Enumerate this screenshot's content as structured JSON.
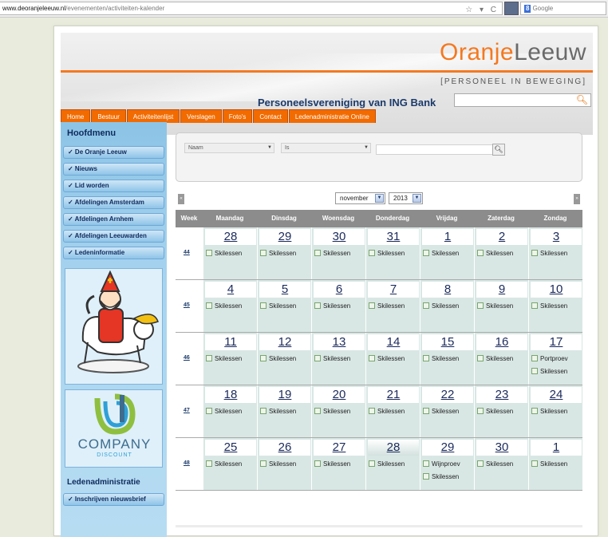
{
  "browser": {
    "url_domain": "www.deoranjeleeuw.nl",
    "url_path": "/evenementen/activiteiten-kalender",
    "url_icons": "☆ ▾ C",
    "search_engine": "8",
    "search_placeholder": "Google"
  },
  "header": {
    "logo_part1": "Oranje",
    "logo_part2": "Leeuw",
    "tagline": "[PERSONEEL IN BEWEGING]",
    "subtitle": "Personeelsvereniging van ING Bank",
    "search_icon": "magnifier-icon"
  },
  "nav": [
    "Home",
    "Bestuur",
    "Activiteitenlijst",
    "Verslagen",
    "Foto's",
    "Contact",
    "Ledenadministratie Online"
  ],
  "sidebar": {
    "title": "Hoofdmenu",
    "items": [
      "✓ De Oranje Leeuw",
      "✓ Nieuws",
      "✓ Lid worden",
      "✓ Afdelingen Amsterdam",
      "✓ Afdelingen Arnhem",
      "✓ Afdelingen Leeuwarden",
      "✓ Ledeninformatie"
    ],
    "company_word": "COMPANY",
    "company_sub": "DISCOUNT",
    "ledenadmin_title": "Ledenadministratie",
    "ledenadmin_item": "✓ Inschrijven nieuwsbrief"
  },
  "filters": {
    "category": "Naam",
    "operator": "Is",
    "search_button": "magnifier-icon",
    "month": "november",
    "year": "2013",
    "prev": "«",
    "next": "»"
  },
  "calendar": {
    "headers": [
      "Week",
      "Maandag",
      "Dinsdag",
      "Woensdag",
      "Donderdag",
      "Vrijdag",
      "Zaterdag",
      "Zondag"
    ],
    "rows": [
      {
        "week": "44",
        "days": [
          {
            "num": "28",
            "events": [
              "Skilessen"
            ]
          },
          {
            "num": "29",
            "events": [
              "Skilessen"
            ]
          },
          {
            "num": "30",
            "events": [
              "Skilessen"
            ]
          },
          {
            "num": "31",
            "events": [
              "Skilessen"
            ]
          },
          {
            "num": "1",
            "events": [
              "Skilessen"
            ]
          },
          {
            "num": "2",
            "events": [
              "Skilessen"
            ]
          },
          {
            "num": "3",
            "events": [
              "Skilessen"
            ]
          }
        ]
      },
      {
        "week": "45",
        "days": [
          {
            "num": "4",
            "events": [
              "Skilessen"
            ]
          },
          {
            "num": "5",
            "events": [
              "Skilessen"
            ]
          },
          {
            "num": "6",
            "events": [
              "Skilessen"
            ]
          },
          {
            "num": "7",
            "events": [
              "Skilessen"
            ]
          },
          {
            "num": "8",
            "events": [
              "Skilessen"
            ]
          },
          {
            "num": "9",
            "events": [
              "Skilessen"
            ]
          },
          {
            "num": "10",
            "events": [
              "Skilessen"
            ]
          }
        ]
      },
      {
        "week": "46",
        "days": [
          {
            "num": "11",
            "events": [
              "Skilessen"
            ]
          },
          {
            "num": "12",
            "events": [
              "Skilessen"
            ]
          },
          {
            "num": "13",
            "events": [
              "Skilessen"
            ]
          },
          {
            "num": "14",
            "events": [
              "Skilessen"
            ]
          },
          {
            "num": "15",
            "events": [
              "Skilessen"
            ]
          },
          {
            "num": "16",
            "events": [
              "Skilessen"
            ]
          },
          {
            "num": "17",
            "events": [
              "Portproev",
              "Skilessen"
            ]
          }
        ]
      },
      {
        "week": "47",
        "days": [
          {
            "num": "18",
            "events": [
              "Skilessen"
            ]
          },
          {
            "num": "19",
            "events": [
              "Skilessen"
            ]
          },
          {
            "num": "20",
            "events": [
              "Skilessen"
            ]
          },
          {
            "num": "21",
            "events": [
              "Skilessen"
            ]
          },
          {
            "num": "22",
            "events": [
              "Skilessen"
            ]
          },
          {
            "num": "23",
            "events": [
              "Skilessen"
            ]
          },
          {
            "num": "24",
            "events": [
              "Skilessen"
            ]
          }
        ]
      },
      {
        "week": "48",
        "days": [
          {
            "num": "25",
            "events": [
              "Skilessen"
            ]
          },
          {
            "num": "26",
            "events": [
              "Skilessen"
            ]
          },
          {
            "num": "27",
            "events": [
              "Skilessen"
            ]
          },
          {
            "num": "28",
            "events": [
              "Skilessen"
            ],
            "today": true
          },
          {
            "num": "29",
            "events": [
              "Wijnproev",
              "Skilessen"
            ]
          },
          {
            "num": "30",
            "events": [
              "Skilessen"
            ]
          },
          {
            "num": "1",
            "events": [
              "Skilessen"
            ]
          }
        ]
      }
    ]
  },
  "colors": {
    "accent": "#f26b00",
    "sidebar": "#8cc4e6",
    "calendar_header": "#8c8c8c",
    "cell": "#d8e7e4"
  }
}
